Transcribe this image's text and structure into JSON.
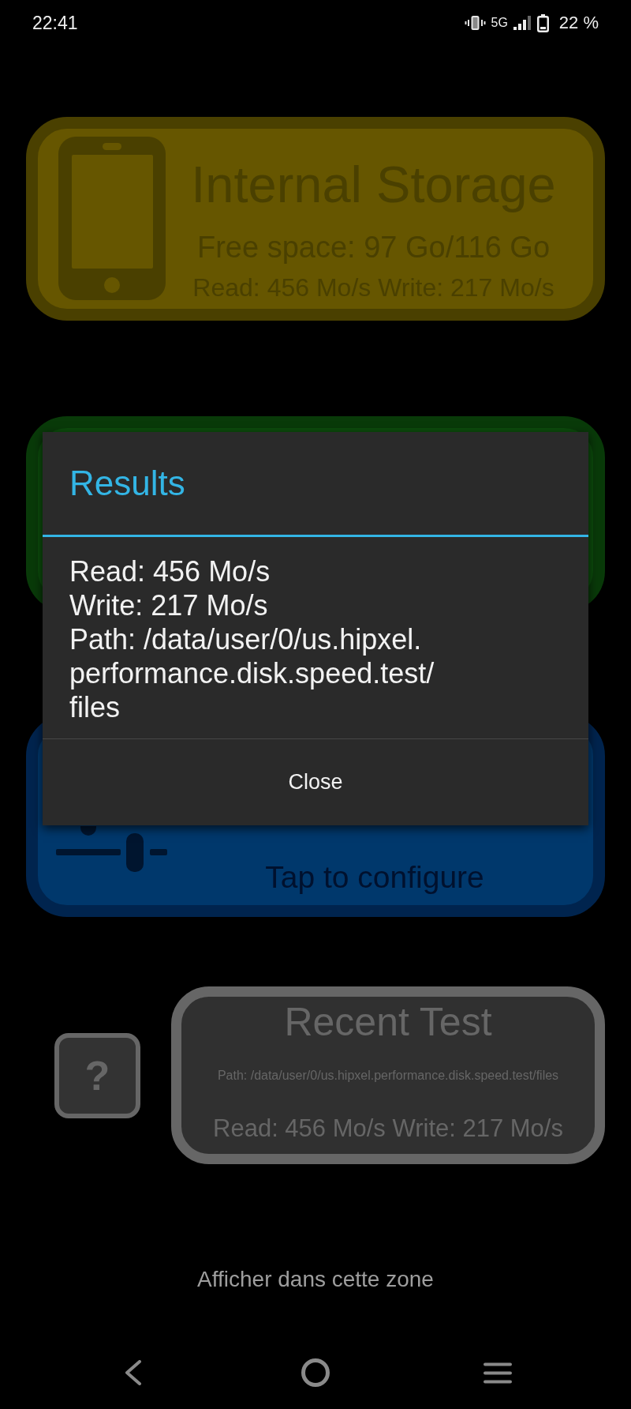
{
  "status_bar": {
    "time": "22:41",
    "network": "5G",
    "battery": "22 %"
  },
  "storage_card": {
    "title": "Internal Storage",
    "free_space": "Free space: 97 Go/116 Go",
    "speeds": "Read: 456 Mo/s Write: 217 Mo/s"
  },
  "dialog": {
    "title": "Results",
    "message_lines": [
      "Read: 456 Mo/s",
      "Write: 217 Mo/s",
      "Path: /data/user/0/us.hipxel.",
      "performance.disk.speed.test/",
      "files"
    ],
    "button": "Close"
  },
  "configure_card": {
    "hint": "Tap to configure"
  },
  "help_button": {
    "label": "?"
  },
  "recent_test": {
    "title": "Recent Test",
    "path": "Path: /data/user/0/us.hipxel.performance.disk.speed.test/files",
    "speeds": "Read: 456 Mo/s Write: 217 Mo/s"
  },
  "display_prompt": "Afficher dans cette zone"
}
